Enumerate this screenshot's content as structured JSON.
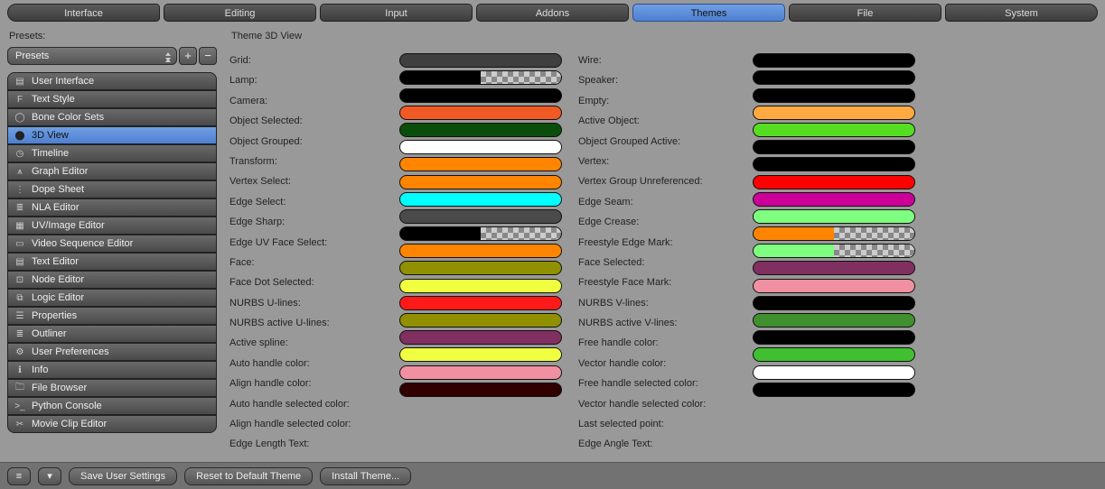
{
  "tabs": [
    "Interface",
    "Editing",
    "Input",
    "Addons",
    "Themes",
    "File",
    "System"
  ],
  "tabs_active": 4,
  "presets_label": "Presets:",
  "presets_value": "Presets",
  "theme_title": "Theme 3D View",
  "categories": [
    {
      "icon": "▤",
      "label": "User Interface"
    },
    {
      "icon": "F",
      "label": "Text Style"
    },
    {
      "icon": "◯",
      "label": "Bone Color Sets"
    },
    {
      "icon": "⬤",
      "label": "3D View"
    },
    {
      "icon": "◷",
      "label": "Timeline"
    },
    {
      "icon": "⩚",
      "label": "Graph Editor"
    },
    {
      "icon": "⋮",
      "label": "Dope Sheet"
    },
    {
      "icon": "≣",
      "label": "NLA Editor"
    },
    {
      "icon": "▦",
      "label": "UV/Image Editor"
    },
    {
      "icon": "▭",
      "label": "Video Sequence Editor"
    },
    {
      "icon": "▤",
      "label": "Text Editor"
    },
    {
      "icon": "⊡",
      "label": "Node Editor"
    },
    {
      "icon": "⧉",
      "label": "Logic Editor"
    },
    {
      "icon": "☰",
      "label": "Properties"
    },
    {
      "icon": "≣",
      "label": "Outliner"
    },
    {
      "icon": "⚙",
      "label": "User Preferences"
    },
    {
      "icon": "ℹ",
      "label": "Info"
    },
    {
      "icon": "🗀",
      "label": "File Browser"
    },
    {
      "icon": ">_",
      "label": "Python Console"
    },
    {
      "icon": "✂",
      "label": "Movie Clip Editor"
    }
  ],
  "categories_active": 3,
  "left_props": [
    {
      "label": "Grid:",
      "color": "#3f3f3f",
      "alpha": false
    },
    {
      "label": "Lamp:",
      "color": "#000000",
      "alpha": true
    },
    {
      "label": "Camera:",
      "color": "#000000",
      "alpha": false
    },
    {
      "label": "Object Selected:",
      "color": "#f15a24",
      "alpha": false
    },
    {
      "label": "Object Grouped:",
      "color": "#0b4d0b",
      "alpha": false
    },
    {
      "label": "Transform:",
      "color": "#ffffff",
      "alpha": false
    },
    {
      "label": "Vertex Select:",
      "color": "#ff8500",
      "alpha": false
    },
    {
      "label": "Edge Select:",
      "color": "#ff8500",
      "alpha": false
    },
    {
      "label": "Edge Sharp:",
      "color": "#00ffff",
      "alpha": false
    },
    {
      "label": "Edge UV Face Select:",
      "color": "#4b4b4b",
      "alpha": false
    },
    {
      "label": "Face:",
      "color": "#000000",
      "alpha": true
    },
    {
      "label": "Face Dot Selected:",
      "color": "#ff8500",
      "alpha": false
    },
    {
      "label": "NURBS U-lines:",
      "color": "#909000",
      "alpha": false
    },
    {
      "label": "NURBS active U-lines:",
      "color": "#f0ff40",
      "alpha": false
    },
    {
      "label": "Active spline:",
      "color": "#ff1a1a",
      "alpha": false
    },
    {
      "label": "Auto handle color:",
      "color": "#909000",
      "alpha": false
    },
    {
      "label": "Align handle color:",
      "color": "#803060",
      "alpha": false
    },
    {
      "label": "Auto handle selected color:",
      "color": "#f0ff40",
      "alpha": false
    },
    {
      "label": "Align handle selected color:",
      "color": "#f090a0",
      "alpha": false
    },
    {
      "label": "Edge Length Text:",
      "color": "#300000",
      "alpha": false
    }
  ],
  "right_props": [
    {
      "label": "Wire:",
      "color": "#000000",
      "alpha": false
    },
    {
      "label": "Speaker:",
      "color": "#000000",
      "alpha": false
    },
    {
      "label": "Empty:",
      "color": "#000000",
      "alpha": false
    },
    {
      "label": "Active Object:",
      "color": "#ffaa40",
      "alpha": false
    },
    {
      "label": "Object Grouped Active:",
      "color": "#55dd22",
      "alpha": false
    },
    {
      "label": "Vertex:",
      "color": "#000000",
      "alpha": false
    },
    {
      "label": "Vertex Group Unreferenced:",
      "color": "#000000",
      "alpha": false
    },
    {
      "label": "Edge Seam:",
      "color": "#ff0000",
      "alpha": false
    },
    {
      "label": "Edge Crease:",
      "color": "#cc0099",
      "alpha": false
    },
    {
      "label": "Freestyle Edge Mark:",
      "color": "#7fff7f",
      "alpha": false
    },
    {
      "label": "Face Selected:",
      "color": "#ff8500",
      "alpha": true
    },
    {
      "label": "Freestyle Face Mark:",
      "color": "#7fff7f",
      "alpha": true
    },
    {
      "label": "NURBS V-lines:",
      "color": "#803060",
      "alpha": false
    },
    {
      "label": "NURBS active V-lines:",
      "color": "#f090a0",
      "alpha": false
    },
    {
      "label": "Free handle color:",
      "color": "#000000",
      "alpha": false
    },
    {
      "label": "Vector handle color:",
      "color": "#409030",
      "alpha": false
    },
    {
      "label": "Free handle selected color:",
      "color": "#000000",
      "alpha": false
    },
    {
      "label": "Vector handle selected color:",
      "color": "#40c030",
      "alpha": false
    },
    {
      "label": "Last selected point:",
      "color": "#ffffff",
      "alpha": false
    },
    {
      "label": "Edge Angle Text:",
      "color": "#000000",
      "alpha": false
    }
  ],
  "bottom": {
    "save": "Save User Settings",
    "reset": "Reset to Default Theme",
    "install": "Install Theme..."
  }
}
